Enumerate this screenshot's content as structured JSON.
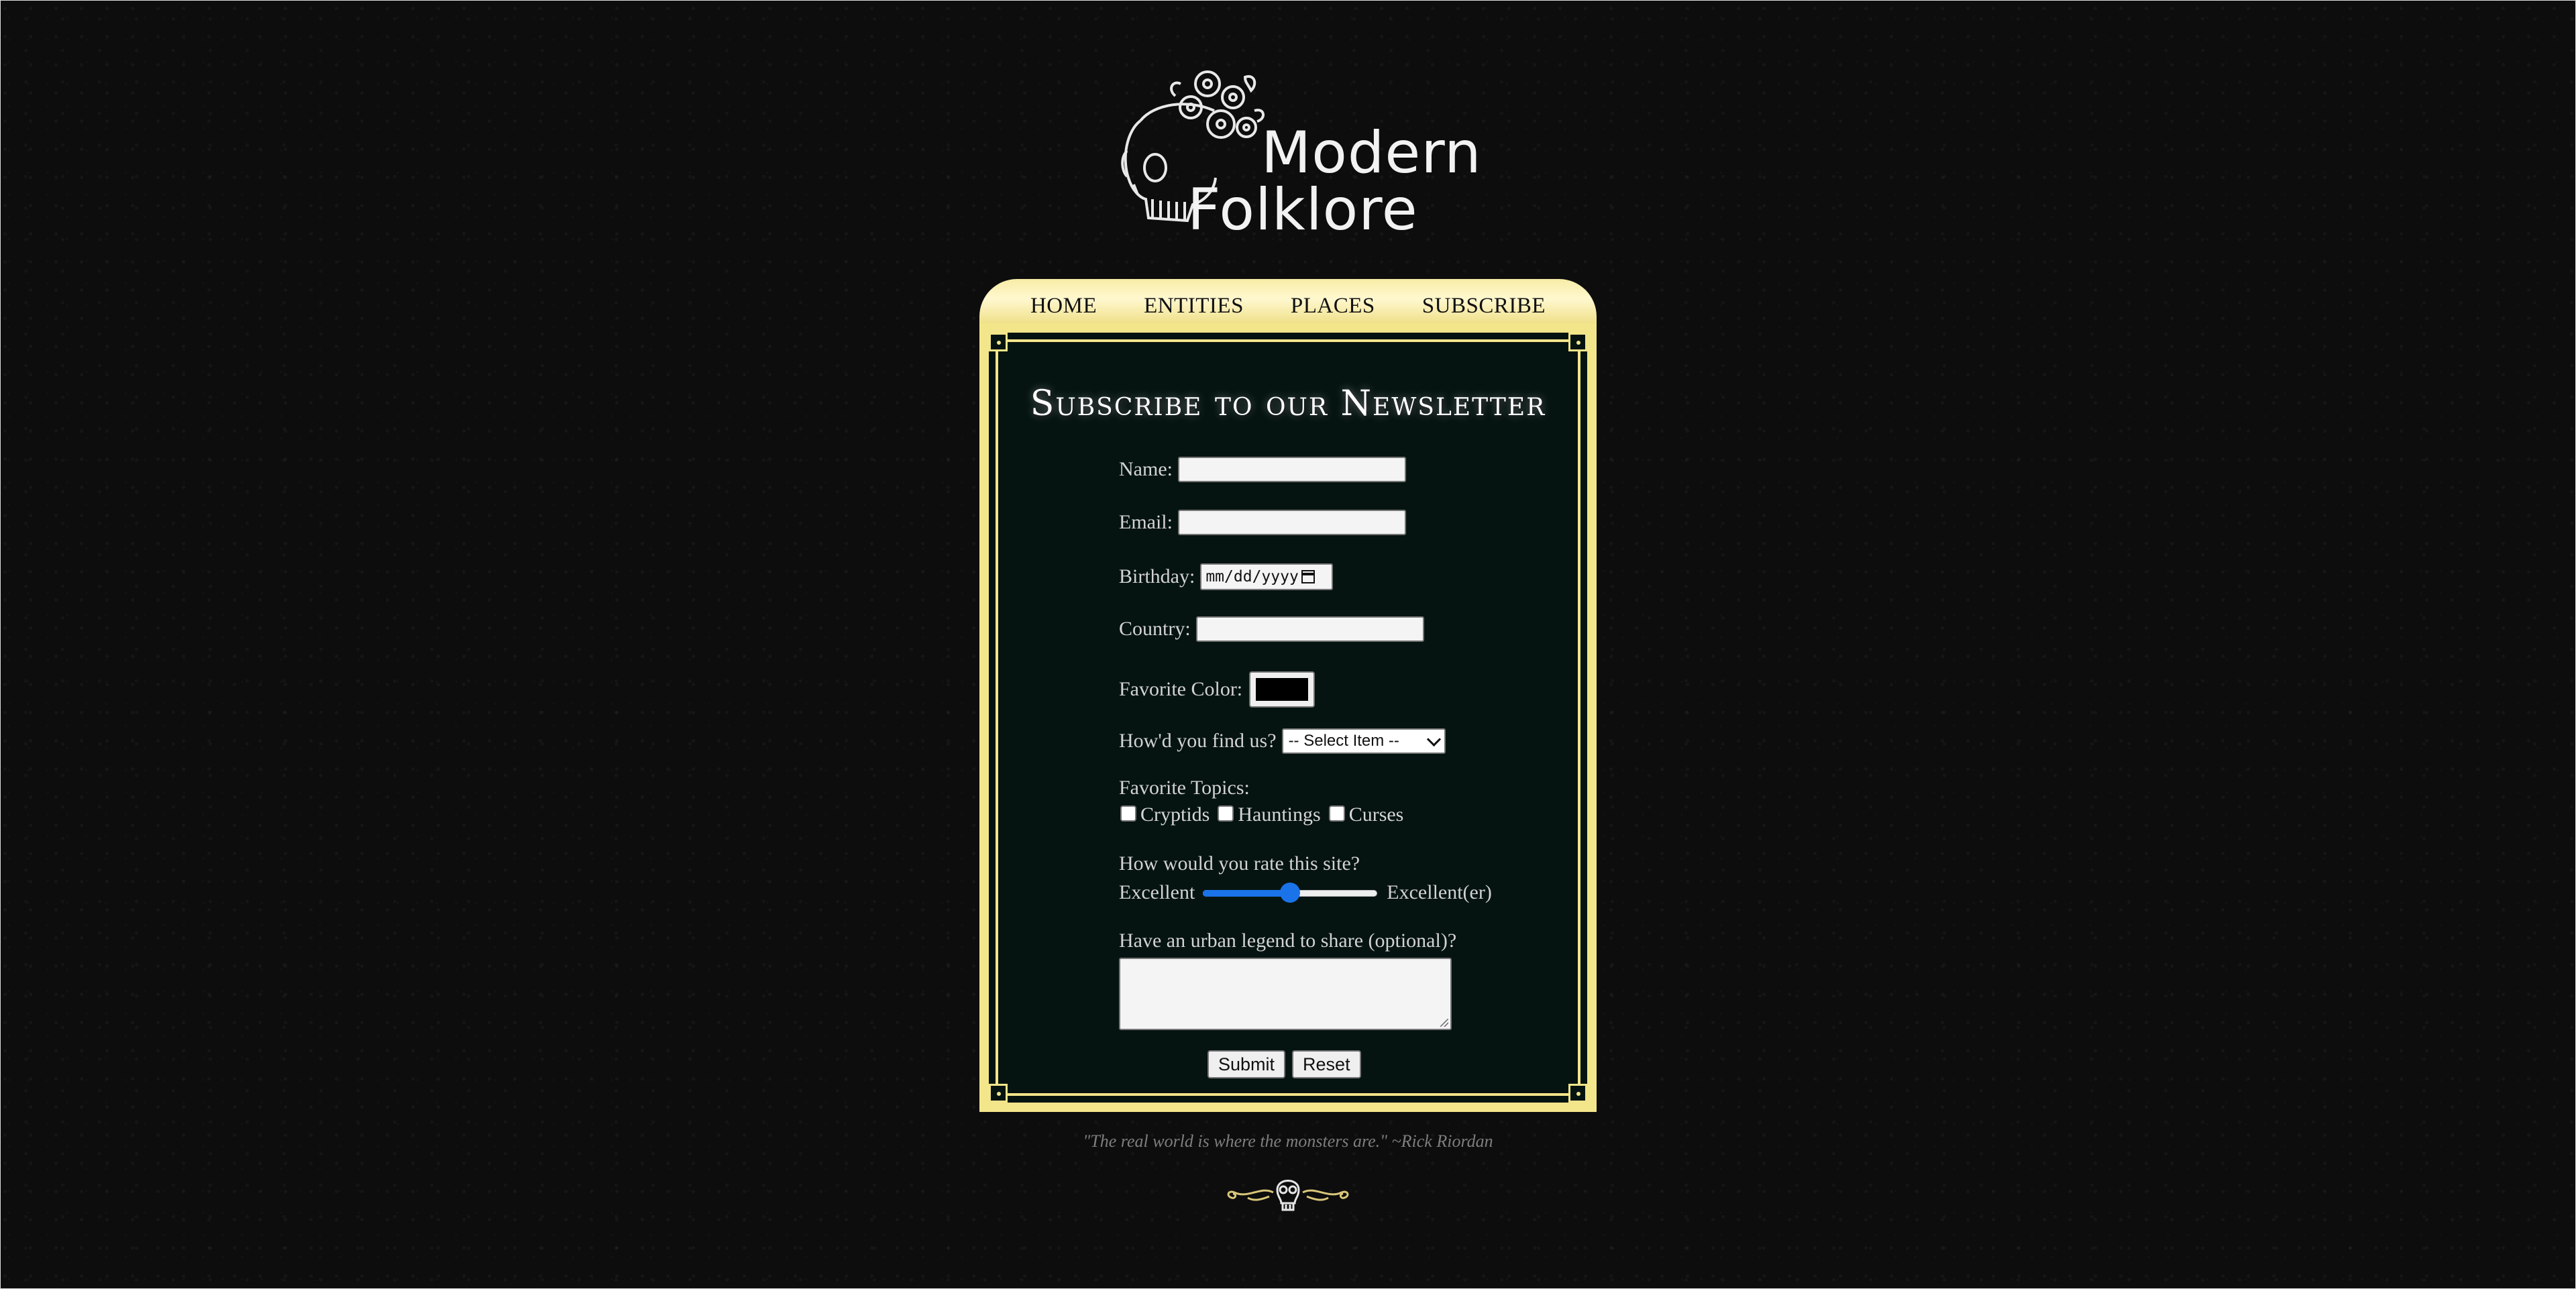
{
  "site": {
    "logo_line1": "Modern",
    "logo_line2": "Folklore"
  },
  "nav": {
    "items": [
      "HOME",
      "ENTITIES",
      "PLACES",
      "SUBSCRIBE"
    ]
  },
  "form": {
    "title": "Subscribe to our Newsletter",
    "name_label": "Name:",
    "name_value": "",
    "email_label": "Email:",
    "email_value": "",
    "birthday_label": "Birthday:",
    "birthday_placeholder": "mm/dd/yyyy",
    "country_label": "Country:",
    "country_value": "",
    "color_label": "Favorite Color:",
    "color_value": "#000000",
    "source_label": "How'd you find us?",
    "source_selected": "-- Select Item --",
    "topics_label": "Favorite Topics:",
    "topics": [
      {
        "label": "Cryptids",
        "checked": false
      },
      {
        "label": "Hauntings",
        "checked": false
      },
      {
        "label": "Curses",
        "checked": false
      }
    ],
    "rating_label": "How would you rate this site?",
    "rating_min_label": "Excellent",
    "rating_max_label": "Excellent(er)",
    "rating_value": 0.5,
    "legend_label": "Have an urban legend to share (optional)?",
    "legend_value": "",
    "submit_label": "Submit",
    "reset_label": "Reset"
  },
  "footer": {
    "quote": "\"The real world is where the monsters are.\" ~Rick Riordan"
  },
  "colors": {
    "gold": "#f3e58a",
    "panel_bg": "#061411",
    "slider_accent": "#1a73e8"
  }
}
